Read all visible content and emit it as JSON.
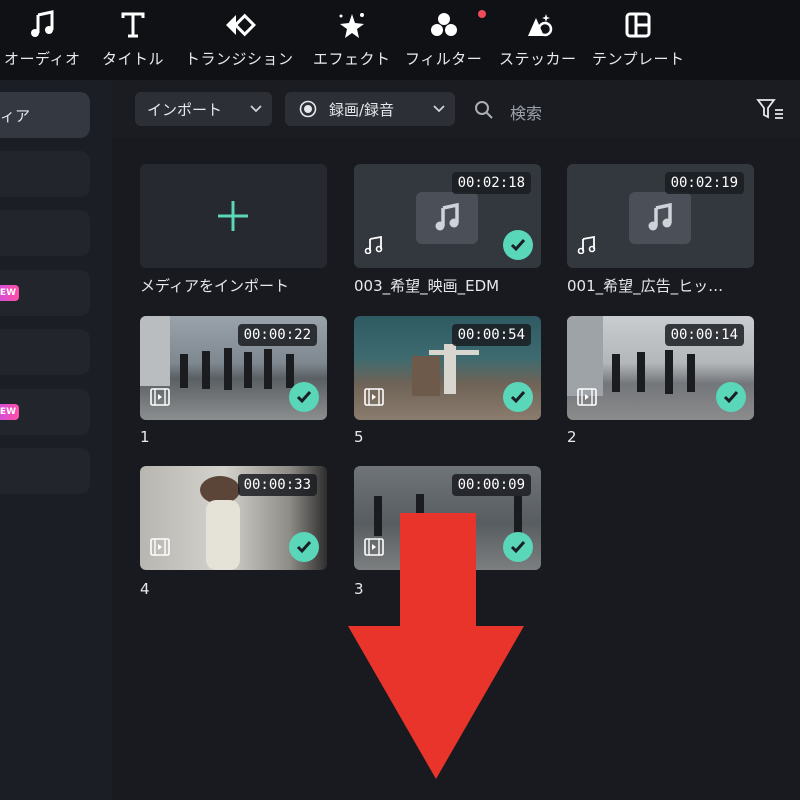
{
  "toolbar_top": {
    "items": [
      {
        "label": "オーディオ",
        "icon": "music-note-icon"
      },
      {
        "label": "タイトル",
        "icon": "text-t-icon"
      },
      {
        "label": "トランジション",
        "icon": "transition-icon"
      },
      {
        "label": "エフェクト",
        "icon": "effect-sparkle-icon"
      },
      {
        "label": "フィルター",
        "icon": "filter-circles-icon"
      },
      {
        "label": "ステッカー",
        "icon": "sticker-icon"
      },
      {
        "label": "テンプレート",
        "icon": "template-icon"
      }
    ]
  },
  "sidebar": {
    "active_label": "ィア",
    "badges": [
      "EW",
      "NEW"
    ]
  },
  "media_toolbar": {
    "import_dropdown": "インポート",
    "record_dropdown": "録画/録音",
    "search_placeholder": "検索"
  },
  "media": {
    "import_caption": "メディアをインポート",
    "items": [
      {
        "caption": "003_希望_映画_EDM",
        "duration": "00:02:18",
        "type": "audio"
      },
      {
        "caption": "001_希望_広告_ヒッ…",
        "duration": "00:02:19",
        "type": "audio"
      },
      {
        "caption": "1",
        "duration": "00:00:22",
        "type": "video"
      },
      {
        "caption": "5",
        "duration": "00:00:54",
        "type": "video"
      },
      {
        "caption": "2",
        "duration": "00:00:14",
        "type": "video"
      },
      {
        "caption": "4",
        "duration": "00:00:33",
        "type": "video"
      },
      {
        "caption": "3",
        "duration": "00:00:09",
        "type": "video"
      }
    ]
  },
  "colors": {
    "accent": "#5ad6b8",
    "arrow": "#e8342a",
    "badge_gradient": [
      "#b74dff",
      "#ff4fa3"
    ]
  }
}
